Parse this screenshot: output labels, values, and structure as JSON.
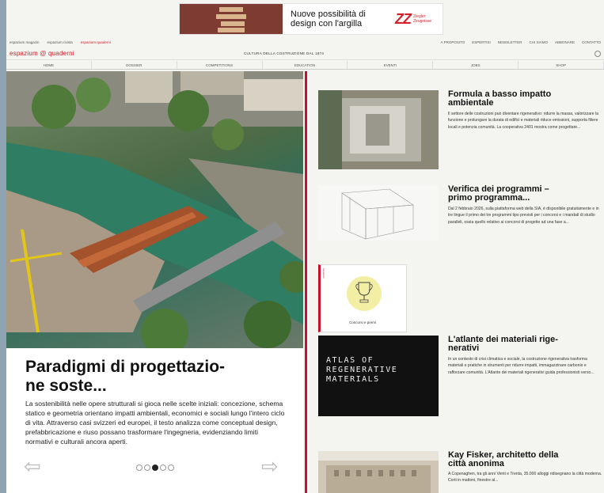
{
  "ad": {
    "headline_line1": "Nuove possibilità di",
    "headline_line2": "design con l'argilla",
    "logo_mark": "ZZ",
    "logo_sub_line1": "Ziegler",
    "logo_sub_line2": "Zeugnisse"
  },
  "toplinks": {
    "left": [
      "espazium magazin",
      "espazium rivista",
      "espazium quaderni"
    ],
    "right": [
      "A PROPOSITO",
      "ESPERTISI",
      "NEWSLETTER",
      "CHI SIAMO",
      "ABBONARE",
      "CONTATTO"
    ]
  },
  "header": {
    "logo": "espazium @ quaderni",
    "tagline": "CULTURA DELLA COSTRUZIONE DAL 1874"
  },
  "nav": [
    "HOME",
    "DOSSIER",
    "COMPETITIONS",
    "EDUCATION",
    "EVENTI",
    "JOBS",
    "SHOP"
  ],
  "hero": {
    "title_line1": "Paradigmi di progettazio-",
    "title_line2": "ne soste...",
    "text": "La sostenibilità nelle opere strutturali si gioca nelle scelte iniziali: concezione, schema statico e geometria orientano impatti ambientali, economici e sociali lungo l'intero ciclo di vita. Attraverso casi svizzeri ed europei, il testo analizza come conceptual design, prefabbricazione e riuso possano trasformare l'ingegneria, evidenziando limiti normativi e culturali ancora aperti.",
    "arrow_left": "⇦",
    "arrow_right": "⇨",
    "slides": 5,
    "active_slide": 3
  },
  "articles": [
    {
      "title_line1": "Formula a basso impatto",
      "title_line2": "ambientale",
      "text": "Il settore delle costruzioni può diventare rigenerativo: ridurre la massa, valorizzare la funzione e prolungare la durata di edifici e materiali riduce emissioni, supporta filiere locali e potenzia comunità. La cooperativa 2401 mostra come progettare..."
    },
    {
      "title_line1": "Verifica dei programmi –",
      "title_line2": "primo programma...",
      "text": "Dal 2 febbraio 2026, sulla piattaforma web della SIA, è disponibile gratuitamente e in tre lingue il primo dei tre programmi tipo previsti per i concorsi e i mandati di studio paralleli, ossia quello relativo ai concorsi di progetto ad una fase a..."
    },
    {
      "title_line1": "L'atlante dei materiali rige-",
      "title_line2": "nerativi",
      "text": "In un contesto di crisi climatica e sociale, la costruzione rigenerativa trasforma materiali e pratiche in strumenti per ridurre impatti, immagazzinare carbonio e rafforzare comunità. L'Atlante dei materiali rigenerativi guida professionisti verso...",
      "thumb_lines": [
        "ATLAS OF",
        "REGENERATIVE",
        "MATERIALS"
      ]
    },
    {
      "title_line1": "Kay Fisker, architetto della",
      "title_line2": "città anonima",
      "text": "A Copenaghen, tra gli anni Venti e Trenta, 35.000 alloggi ridisegnano la città moderna. Corti in mattoni, finestre al..."
    }
  ],
  "card": {
    "side_label": "espazium",
    "label": "Concorsi e premi"
  },
  "colors": {
    "accent": "#c8102e",
    "ad_logo": "#d21f28"
  }
}
